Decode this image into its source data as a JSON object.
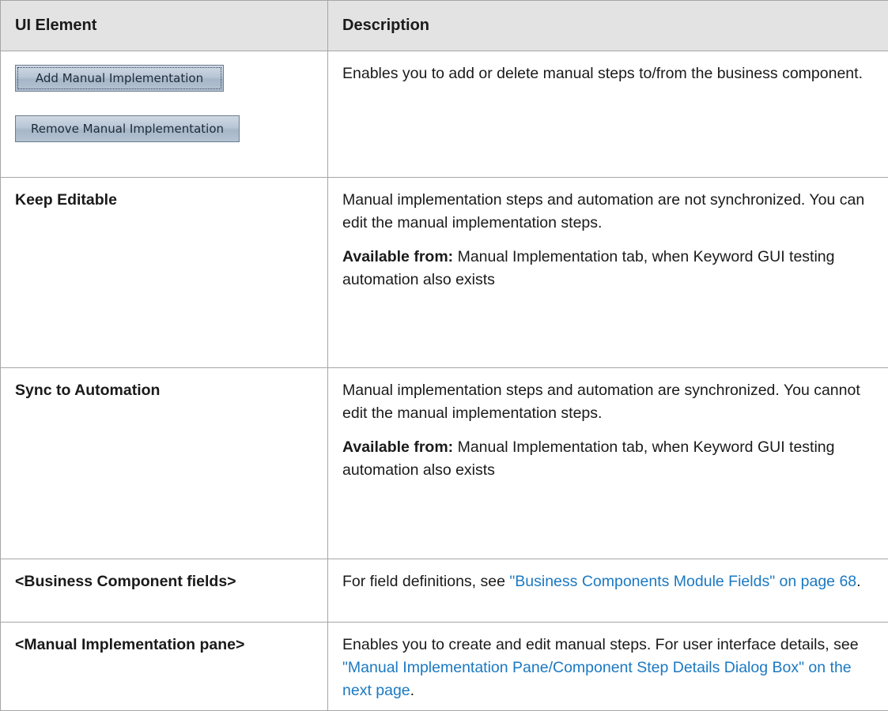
{
  "table": {
    "header": {
      "col_element": "UI Element",
      "col_description": "Description"
    },
    "rows": [
      {
        "buttons": [
          "Add Manual Implementation",
          "Remove Manual Implementation"
        ],
        "description": "Enables you to add or delete manual steps to/from the business component."
      },
      {
        "element": "Keep Editable",
        "description": "Manual implementation steps and automation are not synchronized. You can edit the manual implementation steps.",
        "available_label": "Available from:",
        "available_text": " Manual Implementation tab, when Keyword GUI testing automation also exists"
      },
      {
        "element": "Sync to Automation",
        "description": "Manual implementation steps and automation are synchronized. You cannot edit the manual implementation steps.",
        "available_label": "Available from:",
        "available_text": " Manual Implementation tab, when Keyword GUI testing automation also exists"
      },
      {
        "element": "<Business Component fields>",
        "description_prefix": "For field definitions, see ",
        "link": "\"Business Components Module Fields\" on page 68",
        "description_suffix": "."
      },
      {
        "element": "<Manual Implementation pane>",
        "description_prefix": "Enables you to create and edit manual steps. For user interface details, see ",
        "link": "\"Manual Implementation Pane/Component Step Details Dialog Box\" on the next page",
        "description_suffix": "."
      }
    ]
  },
  "colors": {
    "link": "#1b79c2",
    "header_bg": "#e3e3e3",
    "border": "#a6a6a6"
  }
}
